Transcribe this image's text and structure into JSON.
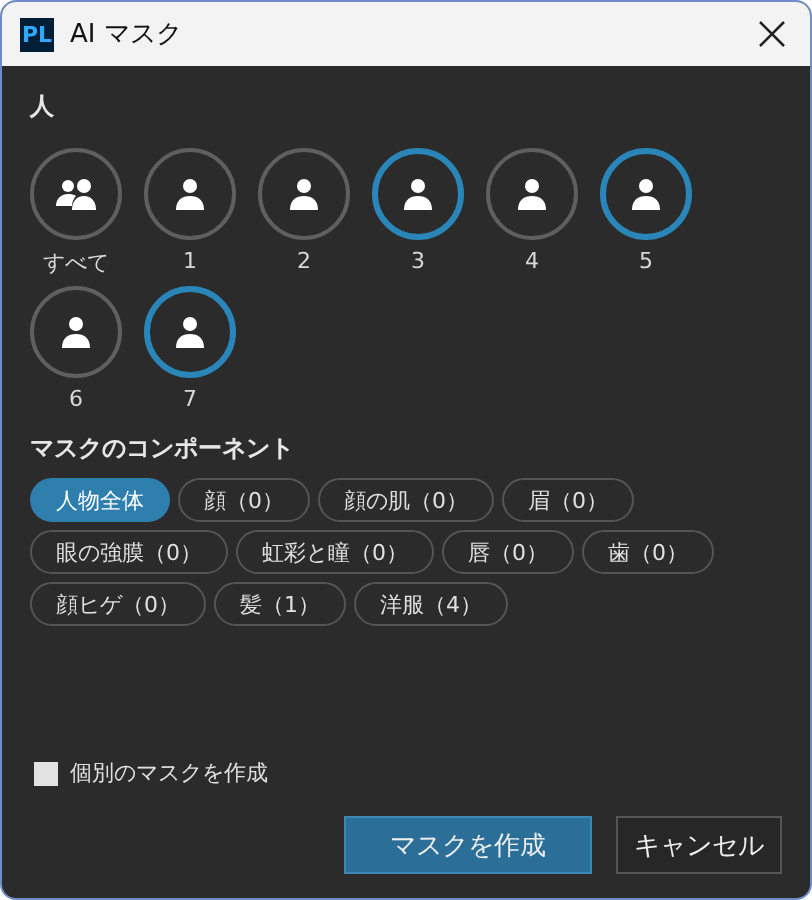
{
  "window": {
    "title": "AI マスク",
    "app_badge": "PL"
  },
  "people": {
    "heading": "人",
    "items": [
      {
        "label": "すべて",
        "kind": "group",
        "selected": false
      },
      {
        "label": "1",
        "kind": "person",
        "selected": false
      },
      {
        "label": "2",
        "kind": "person",
        "selected": false
      },
      {
        "label": "3",
        "kind": "person",
        "selected": true
      },
      {
        "label": "4",
        "kind": "person",
        "selected": false
      },
      {
        "label": "5",
        "kind": "person",
        "selected": true
      },
      {
        "label": "6",
        "kind": "person",
        "selected": false
      },
      {
        "label": "7",
        "kind": "person",
        "selected": true
      }
    ]
  },
  "components": {
    "heading": "マスクのコンポーネント",
    "items": [
      {
        "label": "人物全体",
        "selected": true
      },
      {
        "label": "顔（0）",
        "selected": false
      },
      {
        "label": "顔の肌（0）",
        "selected": false
      },
      {
        "label": "眉（0）",
        "selected": false
      },
      {
        "label": "眼の強膜（0）",
        "selected": false
      },
      {
        "label": "虹彩と瞳（0）",
        "selected": false
      },
      {
        "label": "唇（0）",
        "selected": false
      },
      {
        "label": "歯（0）",
        "selected": false
      },
      {
        "label": "顔ヒゲ（0）",
        "selected": false
      },
      {
        "label": "髪（1）",
        "selected": false
      },
      {
        "label": "洋服（4）",
        "selected": false
      }
    ]
  },
  "separate_masks": {
    "label": "個別のマスクを作成",
    "checked": false
  },
  "buttons": [
    {
      "label": "マスクを作成",
      "kind": "primary"
    },
    {
      "label": "キャンセル",
      "kind": "secondary"
    }
  ]
}
